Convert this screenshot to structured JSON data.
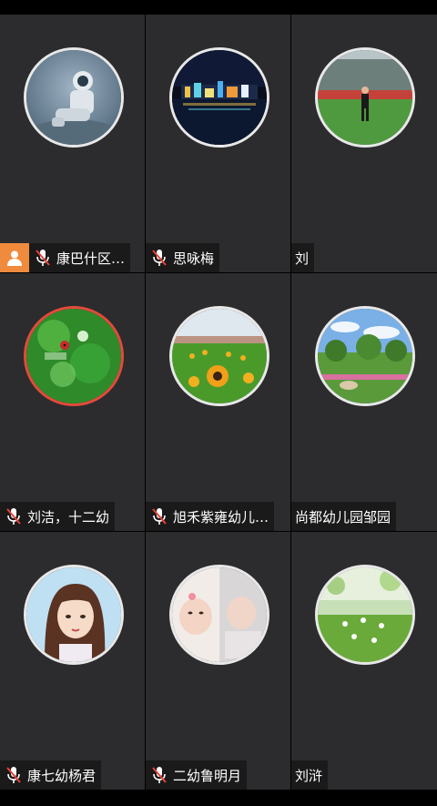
{
  "participants": [
    {
      "name": "康巴什区…",
      "muted": true,
      "host": true,
      "avatar": "astronaut-photo"
    },
    {
      "name": "思咏梅",
      "muted": true,
      "host": false,
      "avatar": "night-city-photo"
    },
    {
      "name": "刘",
      "muted": false,
      "host": false,
      "avatar": "stadium-person-photo"
    },
    {
      "name": "刘洁，十二幼",
      "muted": true,
      "host": false,
      "avatar": "green-ladybug-photo"
    },
    {
      "name": "旭禾紫雍幼儿…",
      "muted": true,
      "host": false,
      "avatar": "sunflower-field-photo"
    },
    {
      "name": "尚都幼儿园邹园",
      "muted": false,
      "host": false,
      "avatar": "park-landscape-photo"
    },
    {
      "name": "康七幼杨君",
      "muted": true,
      "host": false,
      "avatar": "anime-girl-photo"
    },
    {
      "name": "二幼鲁明月",
      "muted": true,
      "host": false,
      "avatar": "baby-photo"
    },
    {
      "name": "刘浒",
      "muted": false,
      "host": false,
      "avatar": "green-blossom-photo"
    }
  ],
  "colors": {
    "tile_bg": "#2c2c2e",
    "host_badge": "#f08a3c",
    "mic_muted": "#e8433a",
    "label_bg": "#1a1a1a"
  }
}
